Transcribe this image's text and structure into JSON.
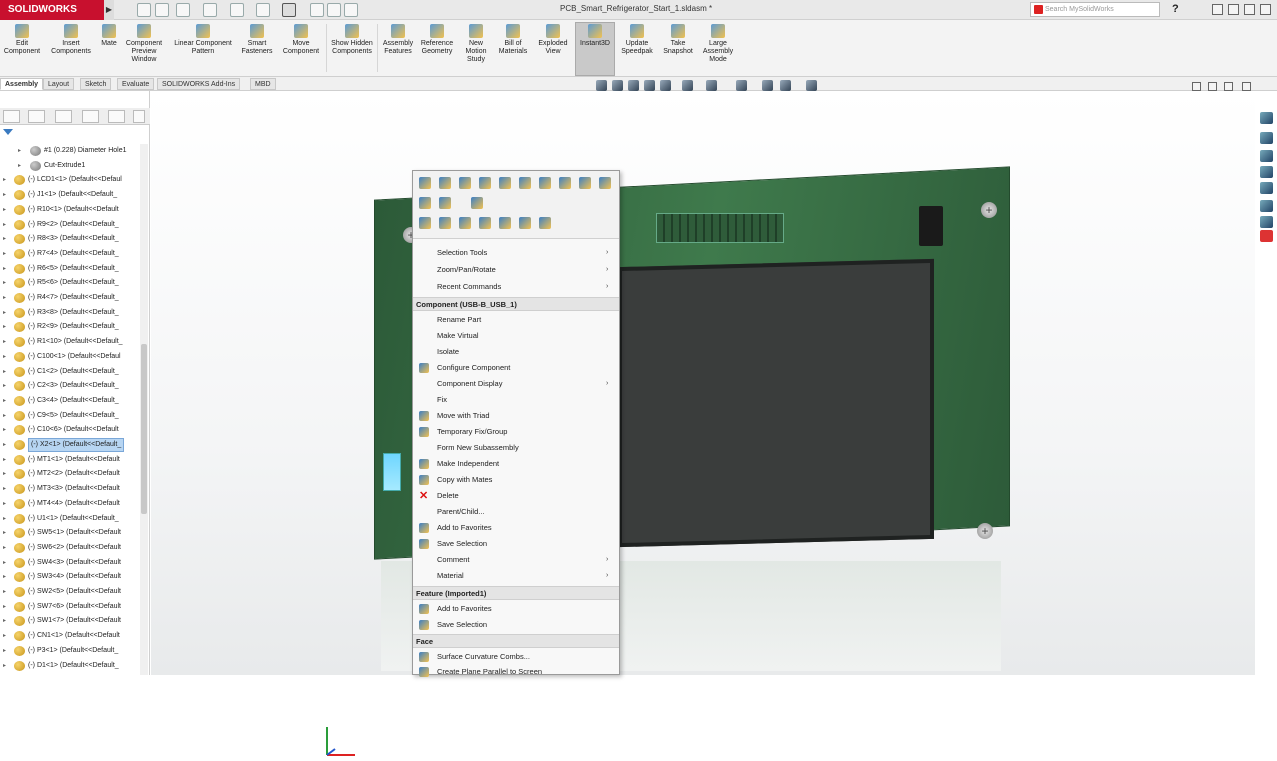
{
  "titlebar": {
    "logo": "SOLIDWORKS",
    "file_title": "PCB_Smart_Refrigerator_Start_1.sldasm *",
    "search_placeholder": "Search MySolidWorks",
    "help": "?"
  },
  "ribbon": {
    "buttons": [
      {
        "label": "Edit Component"
      },
      {
        "label": "Insert Components"
      },
      {
        "label": "Mate"
      },
      {
        "label": "Component Preview Window"
      },
      {
        "label": "Linear Component Pattern"
      },
      {
        "label": "Smart Fasteners"
      },
      {
        "label": "Move Component"
      },
      {
        "label": "Show Hidden Components"
      },
      {
        "label": "Assembly Features"
      },
      {
        "label": "Reference Geometry"
      },
      {
        "label": "New Motion Study"
      },
      {
        "label": "Bill of Materials"
      },
      {
        "label": "Exploded View"
      },
      {
        "label": "Instant3D"
      },
      {
        "label": "Update Speedpak"
      },
      {
        "label": "Take Snapshot"
      },
      {
        "label": "Large Assembly Mode"
      }
    ]
  },
  "tabs": [
    "Assembly",
    "Layout",
    "Sketch",
    "Evaluate",
    "SOLIDWORKS Add-Ins",
    "MBD"
  ],
  "tree": {
    "items": [
      {
        "label": "#1 (0.228) Diameter Hole1"
      },
      {
        "label": "Cut-Extrude1"
      },
      {
        "label": "(-) LCD1<1> (Default<<Defaul"
      },
      {
        "label": "(-) J1<1> (Default<<Default_"
      },
      {
        "label": "(-) R10<1> (Default<<Default"
      },
      {
        "label": "(-) R9<2> (Default<<Default_"
      },
      {
        "label": "(-) R8<3> (Default<<Default_"
      },
      {
        "label": "(-) R7<4> (Default<<Default_"
      },
      {
        "label": "(-) R6<5> (Default<<Default_"
      },
      {
        "label": "(-) R5<6> (Default<<Default_"
      },
      {
        "label": "(-) R4<7> (Default<<Default_"
      },
      {
        "label": "(-) R3<8> (Default<<Default_"
      },
      {
        "label": "(-) R2<9> (Default<<Default_"
      },
      {
        "label": "(-) R1<10> (Default<<Default_"
      },
      {
        "label": "(-) C100<1> (Default<<Defaul"
      },
      {
        "label": "(-) C1<2> (Default<<Default_"
      },
      {
        "label": "(-) C2<3> (Default<<Default_"
      },
      {
        "label": "(-) C3<4> (Default<<Default_"
      },
      {
        "label": "(-) C9<5> (Default<<Default_"
      },
      {
        "label": "(-) C10<6> (Default<<Default"
      },
      {
        "label": "(-) X2<1> (Default<<Default_"
      },
      {
        "label": "(-) MT1<1> (Default<<Default"
      },
      {
        "label": "(-) MT2<2> (Default<<Default"
      },
      {
        "label": "(-) MT3<3> (Default<<Default"
      },
      {
        "label": "(-) MT4<4> (Default<<Default"
      },
      {
        "label": "(-) U1<1> (Default<<Default_"
      },
      {
        "label": "(-) SW5<1> (Default<<Default"
      },
      {
        "label": "(-) SW6<2> (Default<<Default"
      },
      {
        "label": "(-) SW4<3> (Default<<Default"
      },
      {
        "label": "(-) SW3<4> (Default<<Default"
      },
      {
        "label": "(-) SW2<5> (Default<<Default"
      },
      {
        "label": "(-) SW7<6> (Default<<Default"
      },
      {
        "label": "(-) SW1<7> (Default<<Default"
      },
      {
        "label": "(-) CN1<1> (Default<<Default"
      },
      {
        "label": "(-) P3<1> (Default<<Default_"
      },
      {
        "label": "(-) D1<1> (Default<<Default_"
      }
    ]
  },
  "context_menu": {
    "items": [
      {
        "label": "Selection Tools"
      },
      {
        "label": "Zoom/Pan/Rotate"
      },
      {
        "label": "Recent Commands"
      },
      {
        "label": "Component (USB-B_USB_1)"
      },
      {
        "label": "Rename Part"
      },
      {
        "label": "Make Virtual"
      },
      {
        "label": "Isolate"
      },
      {
        "label": "Configure Component"
      },
      {
        "label": "Component Display"
      },
      {
        "label": "Fix"
      },
      {
        "label": "Move with Triad"
      },
      {
        "label": "Temporary Fix/Group"
      },
      {
        "label": "Form New Subassembly"
      },
      {
        "label": "Make Independent"
      },
      {
        "label": "Copy with Mates"
      },
      {
        "label": "Delete"
      },
      {
        "label": "Parent/Child..."
      },
      {
        "label": "Add to Favorites"
      },
      {
        "label": "Save Selection"
      },
      {
        "label": "Comment"
      },
      {
        "label": "Material"
      },
      {
        "label": "Feature (Imported1)"
      },
      {
        "label": "Add to Favorites"
      },
      {
        "label": "Save Selection"
      },
      {
        "label": "Face"
      },
      {
        "label": "Surface Curvature Combs..."
      },
      {
        "label": "Create Plane Parallel to Screen"
      }
    ]
  },
  "colors": {
    "brand": "#c8102e",
    "pcb_green": "#3f7a4c",
    "selection": "#b7d5f2"
  }
}
